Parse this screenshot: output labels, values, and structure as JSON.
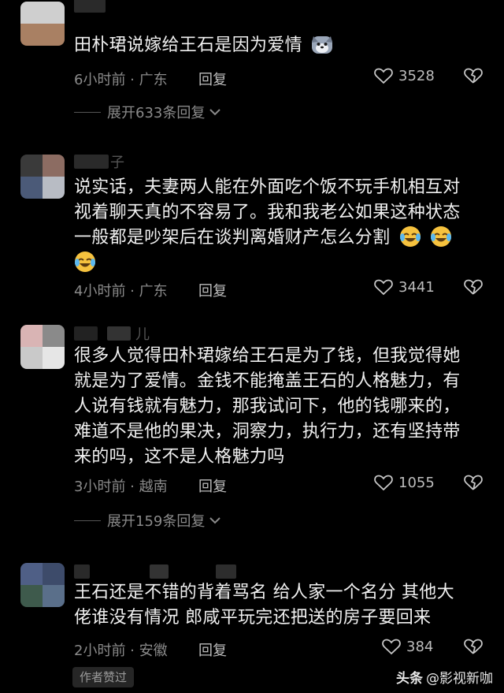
{
  "comments": [
    {
      "name": "",
      "text_lines": [
        "田朴珺说嫁给王石是因为爱情"
      ],
      "time_location": "6小时前 · 广东",
      "reply_label": "回复",
      "likes": "3528",
      "expand_label": "展开633条回复",
      "emoji_tail": "husky-emoji"
    },
    {
      "name": "子",
      "text_lines": [
        "说实话，夫妻两人能在外面吃个饭不玩手机相互对",
        "视着聊天真的不容易了。我和我老公如果这种状态",
        "一般都是吵架后在谈判离婚财产怎么分割"
      ],
      "time_location": "4小时前 · 广东",
      "reply_label": "回复",
      "likes": "3441",
      "emoji_tail": "laugh-cry-emoji"
    },
    {
      "name": "儿",
      "text_lines": [
        "很多人觉得田朴珺嫁给王石是为了钱，但我觉得她",
        "就是为了爱情。金钱不能掩盖王石的人格魅力，有",
        "人说有钱就有魅力，那我试问下，他的钱哪来的，",
        "难道不是他的果决，洞察力，执行力，还有坚持带",
        "来的吗，这不是人格魅力吗"
      ],
      "time_location": "3小时前 · 越南",
      "reply_label": "回复",
      "likes": "1055",
      "expand_label": "展开159条回复"
    },
    {
      "name": "",
      "text_lines": [
        "王石还是不错的背着骂名 给人家一个名分 其他大",
        "佬谁没有情况 郎咸平玩完还把送的房子要回来"
      ],
      "time_location": "2小时前 · 安徽",
      "reply_label": "回复",
      "likes": "384",
      "author_badge": "作者赞过"
    }
  ],
  "watermark": {
    "brand": "头条",
    "handle": "@影视新咖"
  }
}
